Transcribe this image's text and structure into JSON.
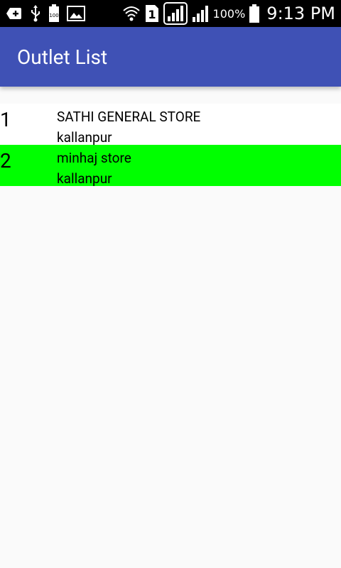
{
  "status_bar": {
    "battery_percent": "100%",
    "time": "9:13 PM",
    "sim_slot": "1",
    "battery_icon_text": "100"
  },
  "app_bar": {
    "title": "Outlet List",
    "color": "#3f51b5"
  },
  "outlets": [
    {
      "index": "1",
      "name": "SATHI GENERAL STORE",
      "area": "kallanpur",
      "selected": false
    },
    {
      "index": "2",
      "name": "minhaj store",
      "area": "kallanpur",
      "selected": true
    }
  ],
  "colors": {
    "selected_row": "#00ff00",
    "background": "#fafafa"
  }
}
